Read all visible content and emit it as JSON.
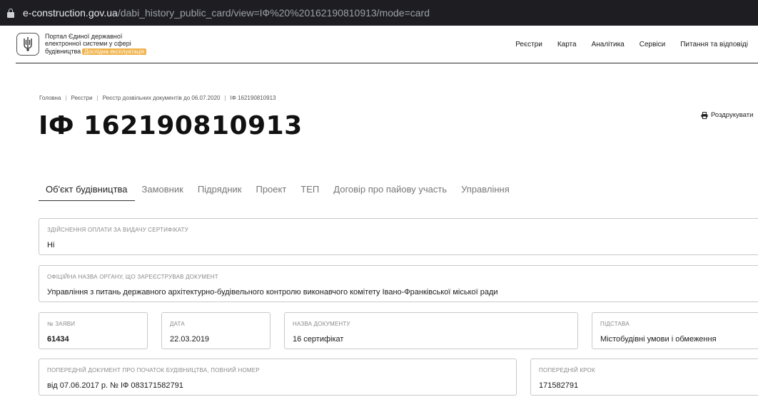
{
  "browser": {
    "url_host": "e-construction.gov.ua",
    "url_path": "/dabi_history_public_card/view=ІФ%20%20162190810913/mode=card"
  },
  "header": {
    "portal_line1": "Портал Єдиної державної",
    "portal_line2": "електронної системи у сфері",
    "portal_line3": "будівництва",
    "badge": "Дослідна експлуатація",
    "nav": [
      "Реєстри",
      "Карта",
      "Аналітика",
      "Сервіси",
      "Питання та відповіді"
    ]
  },
  "breadcrumb": [
    "Головна",
    "Реєстри",
    "Реєстр дозвільних документів до 06.07.2020",
    "ІФ 162190810913"
  ],
  "title": "ІФ 162190810913",
  "print_label": "Роздрукувати",
  "tabs": [
    "Об'єкт будівництва",
    "Замовник",
    "Підрядник",
    "Проект",
    "ТЕП",
    "Договір про пайову участь",
    "Управління"
  ],
  "fields": {
    "payment": {
      "label": "Здійснення оплати за видачу сертифікату",
      "value": "Ні"
    },
    "authority": {
      "label": "Офіційна назва органу, що зареєстрував документ",
      "value": "Управління з питань державного архітектурно-будівельного контролю виконавчого комітету Івано-Франківської міської ради"
    },
    "app_number": {
      "label": "№ заяви",
      "value": "61434"
    },
    "date": {
      "label": "Дата",
      "value": "22.03.2019"
    },
    "doc_name": {
      "label": "Назва документу",
      "value": "16 сертифікат"
    },
    "basis": {
      "label": "Підстава",
      "value": "Містобудівні умови і обмеження"
    },
    "prev_doc": {
      "label": "Попередній документ про початок будівництва, повний номер",
      "value": "від 07.06.2017 р. № ІФ 083171582791"
    },
    "prev_step": {
      "label": "Попередній крок",
      "value": "171582791"
    }
  }
}
